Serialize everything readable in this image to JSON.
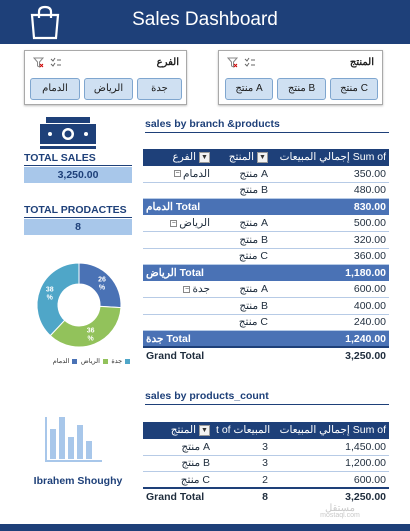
{
  "header": {
    "title": "Sales Dashboard"
  },
  "slicers": [
    {
      "title": "الفرع",
      "items": [
        "جدة",
        "الرياض",
        "الدمام"
      ]
    },
    {
      "title": "المنتج",
      "items": [
        "منتج C",
        "منتج B",
        "منتج A"
      ]
    }
  ],
  "kpis": {
    "total_sales_label": "TOTAL SALES",
    "total_sales_value": "3,250.00",
    "total_products_label": "TOTAL PRODACTES",
    "total_products_value": "8"
  },
  "donut": {
    "segments": [
      {
        "label": "26\n%",
        "value": 26,
        "color": "#4a72b5"
      },
      {
        "label": "36\n%",
        "value": 36,
        "color": "#92c25b"
      },
      {
        "label": "38\n%",
        "value": 38,
        "color": "#4fa6c8"
      }
    ],
    "legend": [
      {
        "label": "جدة",
        "color": "#4fa6c8"
      },
      {
        "label": "الرياض",
        "color": "#92c25b"
      },
      {
        "label": "الدمام",
        "color": "#4a72b5"
      }
    ]
  },
  "table1": {
    "title": "sales by branch &products",
    "headers": {
      "sum": "إجمالي المبيعات Sum of",
      "product": "المنتج",
      "branch": "الفرع"
    },
    "rows": [
      {
        "branch": "الدمام",
        "product": "منتج A",
        "value": "350.00"
      },
      {
        "branch": "",
        "product": "منتج B",
        "value": "480.00"
      },
      {
        "total": "الدمام Total",
        "value": "830.00"
      },
      {
        "branch": "الرياض",
        "product": "منتج A",
        "value": "500.00"
      },
      {
        "branch": "",
        "product": "منتج B",
        "value": "320.00"
      },
      {
        "branch": "",
        "product": "منتج C",
        "value": "360.00"
      },
      {
        "total": "الرياض Total",
        "value": "1,180.00"
      },
      {
        "branch": "جدة",
        "product": "منتج A",
        "value": "600.00"
      },
      {
        "branch": "",
        "product": "منتج B",
        "value": "400.00"
      },
      {
        "branch": "",
        "product": "منتج C",
        "value": "240.00"
      },
      {
        "total": "جدة Total",
        "value": "1,240.00"
      }
    ],
    "grand_label": "Grand Total",
    "grand_value": "3,250.00"
  },
  "table2": {
    "title": "sales by products_count",
    "headers": {
      "sum": "إجمالي المبيعات Sum of",
      "count": "t of المبيعات",
      "product": "المنتج"
    },
    "rows": [
      {
        "product": "منتج A",
        "count": "3",
        "value": "1,450.00"
      },
      {
        "product": "منتج B",
        "count": "3",
        "value": "1,200.00"
      },
      {
        "product": "منتج C",
        "count": "2",
        "value": "600.00"
      }
    ],
    "grand_label": "Grand Total",
    "grand_count": "8",
    "grand_value": "3,250.00"
  },
  "author": {
    "name": "Ibrahem Shoughy"
  },
  "watermark": {
    "arabic": "مستقل",
    "latin": "mostaql.com"
  },
  "icons": {
    "header": "shopping-bag-icon",
    "sales": "money-bill-icon",
    "author": "bar-chart-icon",
    "slicer_multi": "multi-select-icon",
    "slicer_clear": "clear-filter-icon"
  },
  "colors": {
    "primary": "#1e4079",
    "subtotal": "#4a72b5",
    "kpi_fill": "#a8c7ea",
    "slicer_btn": "#cfe0f2"
  }
}
